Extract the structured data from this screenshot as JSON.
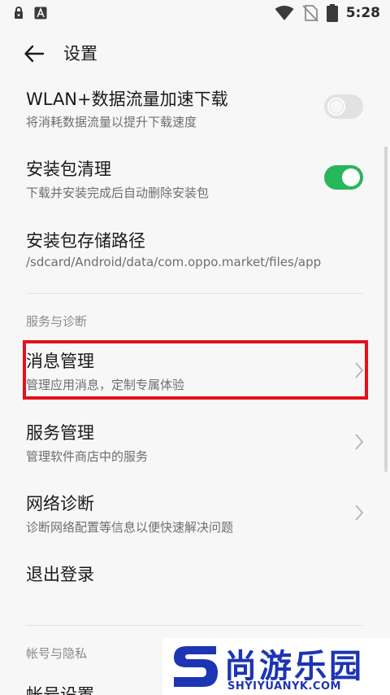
{
  "status_bar": {
    "time": "5:28",
    "left_icons": [
      "lock-icon",
      "text-a-icon"
    ],
    "right_icons": [
      "wifi-icon",
      "no-sim-icon",
      "battery-icon"
    ]
  },
  "header": {
    "title": "设置"
  },
  "settings": [
    {
      "title": "WLAN+数据流量加速下载",
      "subtitle": "将消耗数据流量以提升下载速度",
      "control": "switch",
      "checked": false
    },
    {
      "title": "安装包清理",
      "subtitle": "下载并安装完成后自动删除安装包",
      "control": "switch",
      "checked": true
    },
    {
      "title": "安装包存储路径",
      "subtitle": "/sdcard/Android/data/com.oppo.market/files/app",
      "control": "none"
    }
  ],
  "sections": [
    {
      "header": "服务与诊断",
      "items": [
        {
          "title": "消息管理",
          "subtitle": "管理应用消息，定制专属体验",
          "control": "chevron"
        },
        {
          "title": "服务管理",
          "subtitle": "管理软件商店中的服务",
          "control": "chevron"
        },
        {
          "title": "网络诊断",
          "subtitle": "诊断网络配置等信息以便快速解决问题",
          "control": "chevron"
        },
        {
          "title": "退出登录",
          "control": "none"
        }
      ]
    },
    {
      "header": "帐号与隐私",
      "items": [
        {
          "title": "帐号设置",
          "control": "none"
        }
      ]
    }
  ],
  "colors": {
    "background": "#f7f7f7",
    "switch_on": "#27b65b",
    "switch_off": "#e2e2e2",
    "highlight": "#e3111b",
    "watermark": "#1d35b3"
  },
  "watermark": {
    "logo_letter": "S",
    "text_cn": "尚游乐园",
    "text_en": "SHYIYUANYK.COM"
  }
}
